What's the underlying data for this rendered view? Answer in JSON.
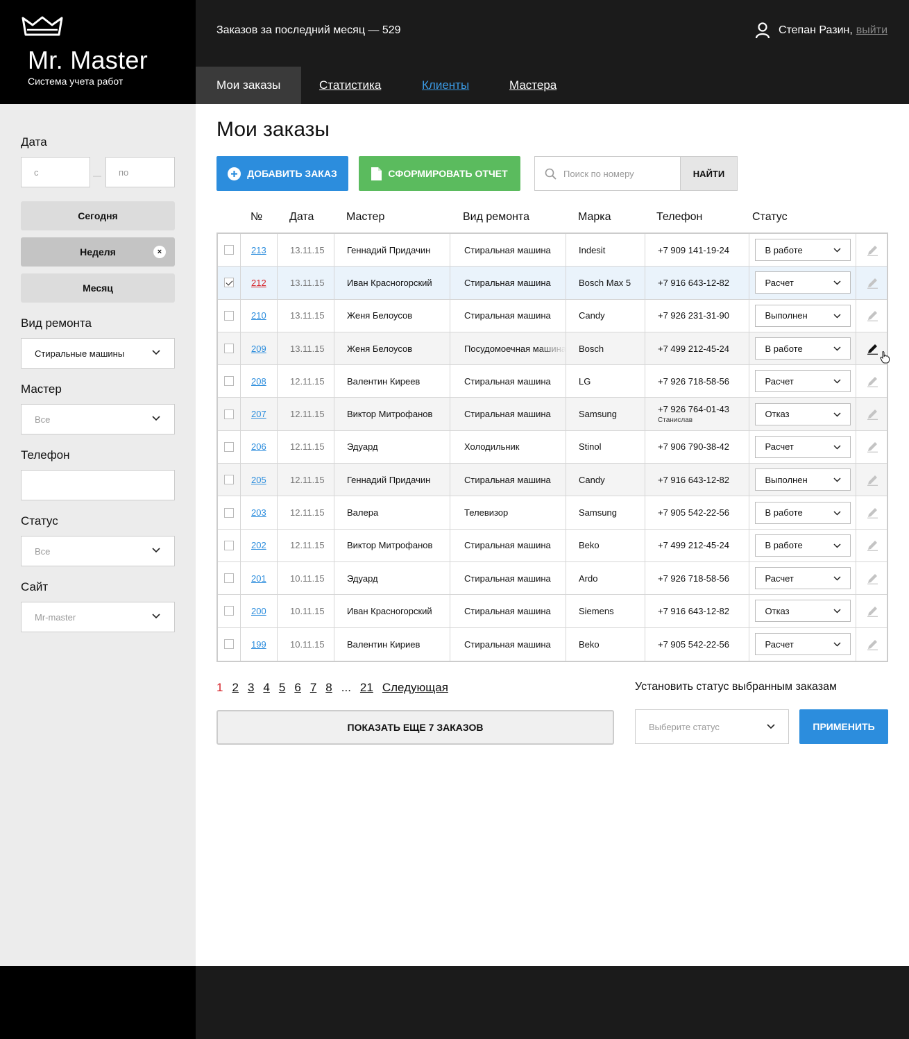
{
  "brand": {
    "title": "Mr. Master",
    "subtitle": "Система учета работ"
  },
  "header": {
    "orders_count": "Заказов за последний месяц — 529",
    "user_name": "Степан Разин,",
    "logout": "выйти"
  },
  "nav": {
    "tabs": [
      "Мои заказы",
      "Статистика",
      "Клиенты",
      "Мастера"
    ]
  },
  "sidebar": {
    "date_label": "Дата",
    "date_from_placeholder": "с",
    "date_to_placeholder": "по",
    "date_dash": "—",
    "period_buttons": [
      "Сегодня",
      "Неделя",
      "Месяц"
    ],
    "period_clear": "×",
    "repair_type_label": "Вид ремонта",
    "repair_type_value": "Стиральные машины",
    "master_label": "Мастер",
    "master_value": "Все",
    "phone_label": "Телефон",
    "status_label": "Статус",
    "status_value": "Все",
    "site_label": "Сайт",
    "site_value": "Mr-master"
  },
  "main": {
    "title": "Мои заказы",
    "add_order": "ДОБАВИТЬ ЗАКАЗ",
    "make_report": "СФОРМИРОВАТЬ ОТЧЕТ",
    "search_placeholder": "Поиск по номеру",
    "search_button": "НАЙТИ"
  },
  "table": {
    "columns": [
      "№",
      "Дата",
      "Мастер",
      "Вид ремонта",
      "Марка",
      "Телефон",
      "Статус"
    ],
    "rows": [
      {
        "num": "213",
        "date": "13.11.15",
        "master": "Геннадий Придачин",
        "type": "Стиральная машина",
        "brand": "Indesit",
        "phone": "+7 909 141-19-24",
        "note": "",
        "status": "В работе"
      },
      {
        "num": "212",
        "date": "13.11.15",
        "master": "Иван Красногорский",
        "type": "Стиральная машина",
        "brand": "Bosch Max 5",
        "phone": "+7 916 643-12-82",
        "note": "",
        "status": "Расчет"
      },
      {
        "num": "210",
        "date": "13.11.15",
        "master": "Женя Белоусов",
        "type": "Стиральная машина",
        "brand": "Candy",
        "phone": "+7 926 231-31-90",
        "note": "",
        "status": "Выполнен"
      },
      {
        "num": "209",
        "date": "13.11.15",
        "master": "Женя Белоусов",
        "type": "Посудомоечная машина",
        "brand": "Bosch",
        "phone": "+7 499 212-45-24",
        "note": "",
        "status": "В работе"
      },
      {
        "num": "208",
        "date": "12.11.15",
        "master": "Валентин Киреев",
        "type": "Стиральная машина",
        "brand": "LG",
        "phone": "+7 926 718-58-56",
        "note": "",
        "status": "Расчет"
      },
      {
        "num": "207",
        "date": "12.11.15",
        "master": "Виктор Митрофанов",
        "type": "Стиральная машина",
        "brand": "Samsung",
        "phone": "+7 926 764-01-43",
        "note": "Станислав",
        "status": "Отказ"
      },
      {
        "num": "206",
        "date": "12.11.15",
        "master": "Эдуард",
        "type": "Холодильник",
        "brand": "Stinol",
        "phone": "+7 906 790-38-42",
        "note": "",
        "status": "Расчет"
      },
      {
        "num": "205",
        "date": "12.11.15",
        "master": "Геннадий Придачин",
        "type": "Стиральная машина",
        "brand": "Candy",
        "phone": "+7 916 643-12-82",
        "note": "",
        "status": "Выполнен"
      },
      {
        "num": "203",
        "date": "12.11.15",
        "master": "Валера",
        "type": "Телевизор",
        "brand": "Samsung",
        "phone": "+7 905 542-22-56",
        "note": "",
        "status": "В работе"
      },
      {
        "num": "202",
        "date": "12.11.15",
        "master": "Виктор Митрофанов",
        "type": "Стиральная машина",
        "brand": "Beko",
        "phone": "+7 499 212-45-24",
        "note": "",
        "status": "В работе"
      },
      {
        "num": "201",
        "date": "10.11.15",
        "master": "Эдуард",
        "type": "Стиральная машина",
        "brand": "Ardo",
        "phone": "+7 926 718-58-56",
        "note": "",
        "status": "Расчет"
      },
      {
        "num": "200",
        "date": "10.11.15",
        "master": "Иван Красногорский",
        "type": "Стиральная машина",
        "brand": "Siemens",
        "phone": "+7 916 643-12-82",
        "note": "",
        "status": "Отказ"
      },
      {
        "num": "199",
        "date": "10.11.15",
        "master": "Валентин Кириев",
        "type": "Стиральная машина",
        "brand": "Beko",
        "phone": "+7 905 542-22-56",
        "note": "",
        "status": "Расчет"
      }
    ]
  },
  "pagination": {
    "pages": [
      "1",
      "2",
      "3",
      "4",
      "5",
      "6",
      "7",
      "8",
      "...",
      "21"
    ],
    "next": "Следующая",
    "show_more": "ПОКАЗАТЬ ЕЩЕ 7 ЗАКАЗОВ"
  },
  "bulk": {
    "label": "Установить статус выбранным заказам",
    "select_placeholder": "Выберите статус",
    "apply": "ПРИМЕНИТЬ"
  },
  "colors": {
    "accent_blue": "#2c8ddd",
    "accent_green": "#5bbb5e",
    "link_red": "#d6242a"
  }
}
